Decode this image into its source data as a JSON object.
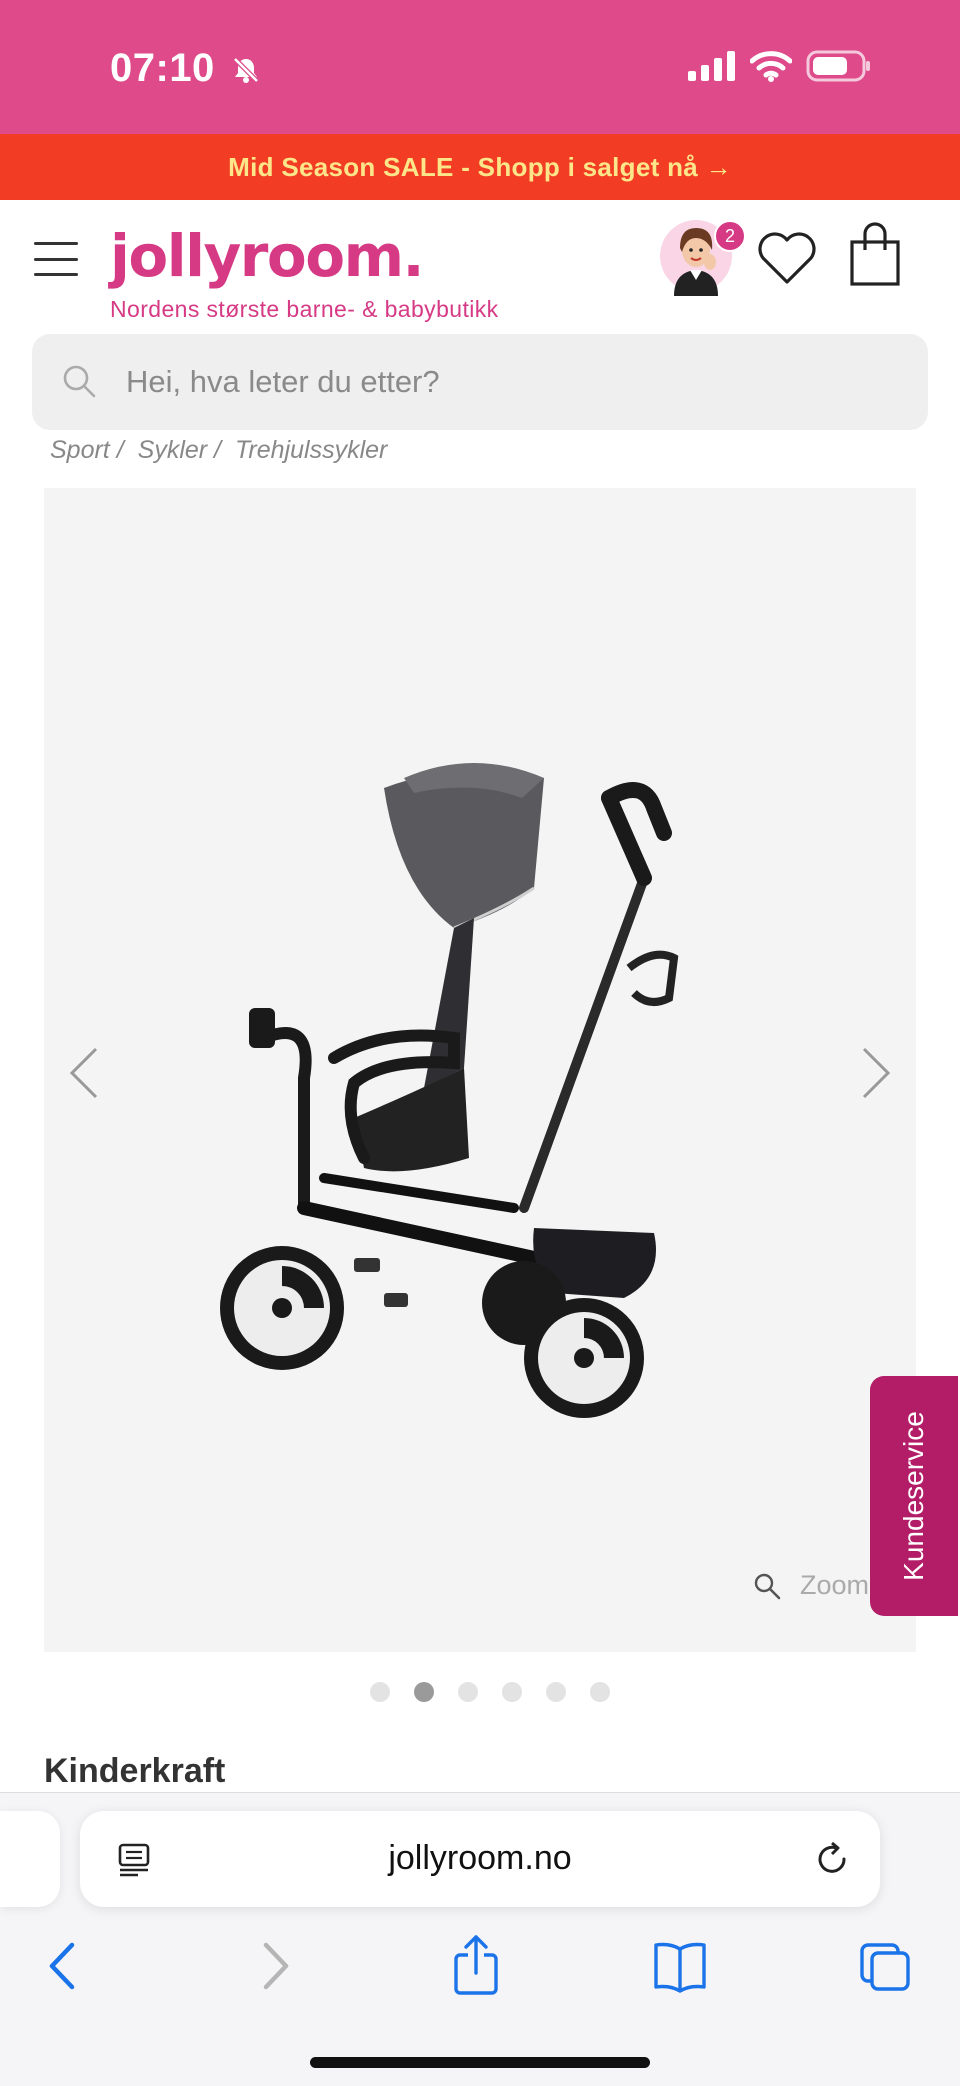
{
  "status_bar": {
    "time": "07:10"
  },
  "promo": {
    "text": "Mid Season SALE - Shopp i salget nå →"
  },
  "header": {
    "logo": "jollyroom.",
    "tagline": "Nordens største barne- & babybutikk",
    "avatar_badge": "2"
  },
  "search": {
    "placeholder": "Hei, hva leter du etter?"
  },
  "breadcrumb": {
    "items": [
      "Sport /",
      "Sykler /",
      "Trehjulssykler"
    ]
  },
  "gallery": {
    "zoom_label": "Zoom",
    "active_index": 2,
    "total_images": 6
  },
  "kundeservice": {
    "label": "Kundeservice"
  },
  "product": {
    "brand": "Kinderkraft"
  },
  "browser": {
    "url": "jollyroom.no"
  },
  "colors": {
    "status_bar": "#de4a8a",
    "promo_bg": "#f23d24",
    "promo_text": "#fde68a",
    "brand_pink": "#d63a85",
    "kundeservice_bg": "#b31d67",
    "ios_blue": "#1a73e8"
  },
  "icons": {
    "menu": "hamburger-icon",
    "wishlist": "heart-icon",
    "cart": "shopping-bag-icon",
    "search": "search-icon",
    "zoom": "magnifier-icon",
    "reader": "reader-mode-icon",
    "reload": "reload-icon",
    "back": "chevron-left-icon",
    "forward": "chevron-right-icon",
    "share": "share-icon",
    "bookmarks": "book-icon",
    "tabs": "tabs-icon"
  }
}
